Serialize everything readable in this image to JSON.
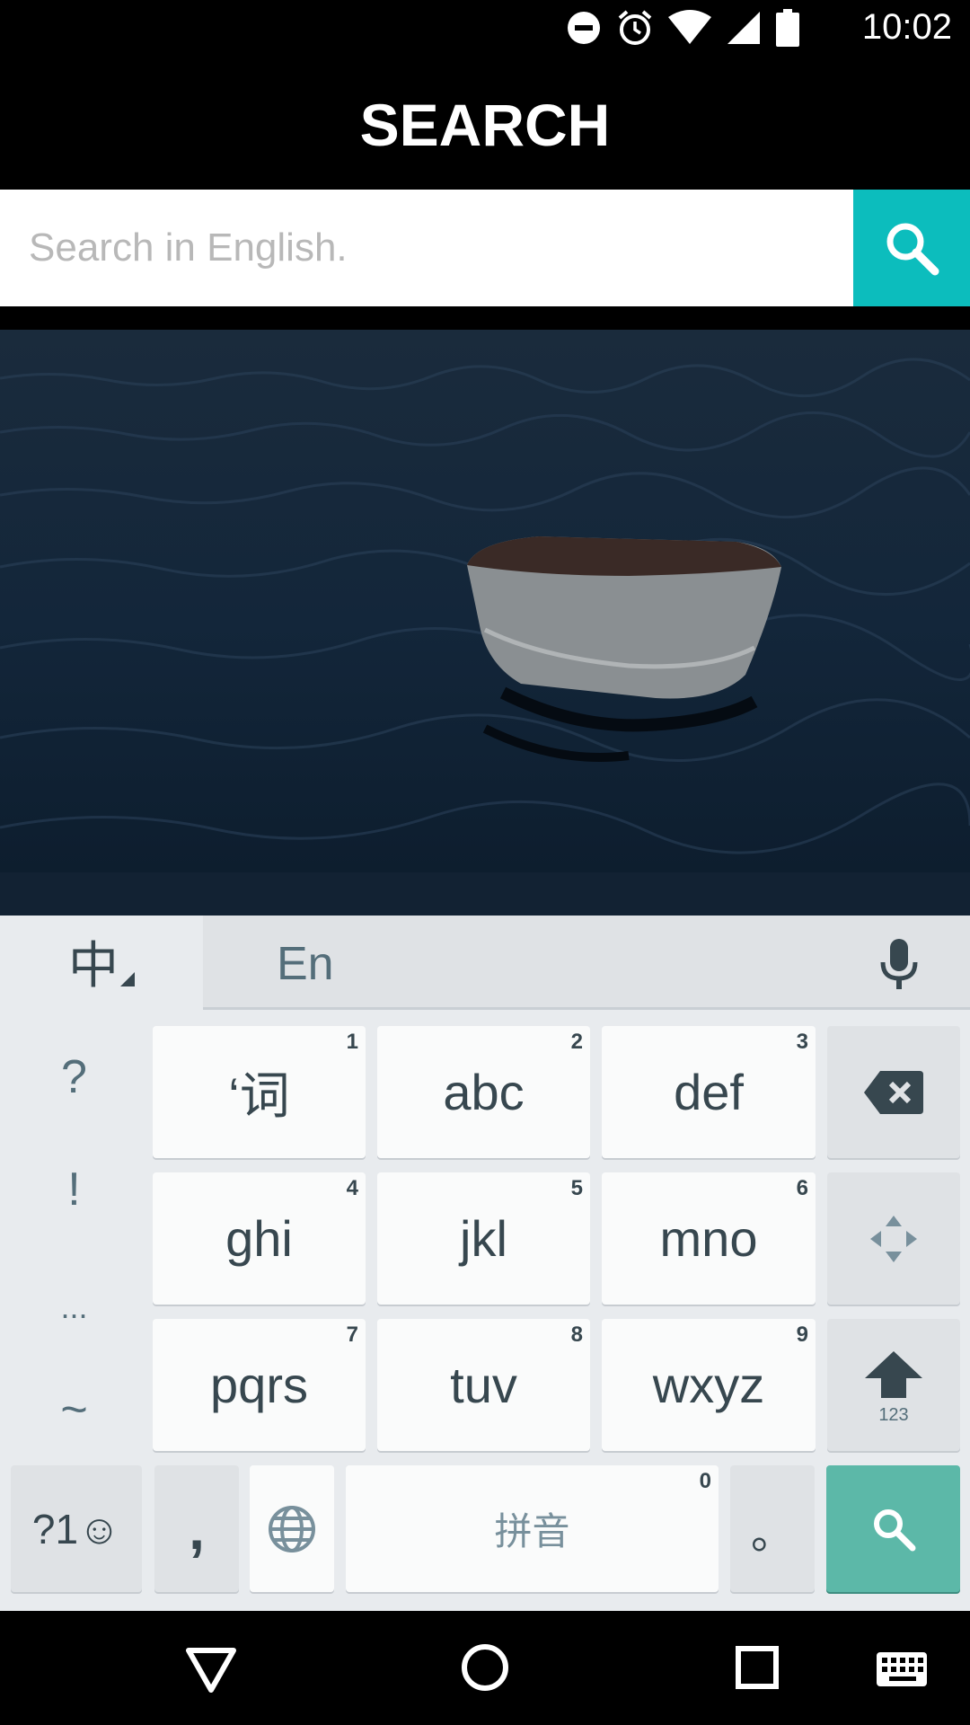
{
  "status": {
    "time": "10:02"
  },
  "header": {
    "title": "SEARCH"
  },
  "search": {
    "placeholder": "Search in English."
  },
  "keyboard": {
    "lang_label": "中",
    "mode_label": "En",
    "side_symbols": [
      "?",
      "!",
      "...",
      "~"
    ],
    "rows": [
      [
        {
          "label": "‘词",
          "num": "1"
        },
        {
          "label": "abc",
          "num": "2"
        },
        {
          "label": "def",
          "num": "3"
        }
      ],
      [
        {
          "label": "ghi",
          "num": "4"
        },
        {
          "label": "jkl",
          "num": "5"
        },
        {
          "label": "mno",
          "num": "6"
        }
      ],
      [
        {
          "label": "pqrs",
          "num": "7"
        },
        {
          "label": "tuv",
          "num": "8"
        },
        {
          "label": "wxyz",
          "num": "9"
        }
      ]
    ],
    "shift_sub": "123",
    "sym_label": "?1☺",
    "comma_label": ",",
    "space_label": "拼音",
    "space_num": "0",
    "period_label": "。",
    "accent_color": "#5cb8a8"
  },
  "colors": {
    "search_button": "#0cbdbd"
  }
}
